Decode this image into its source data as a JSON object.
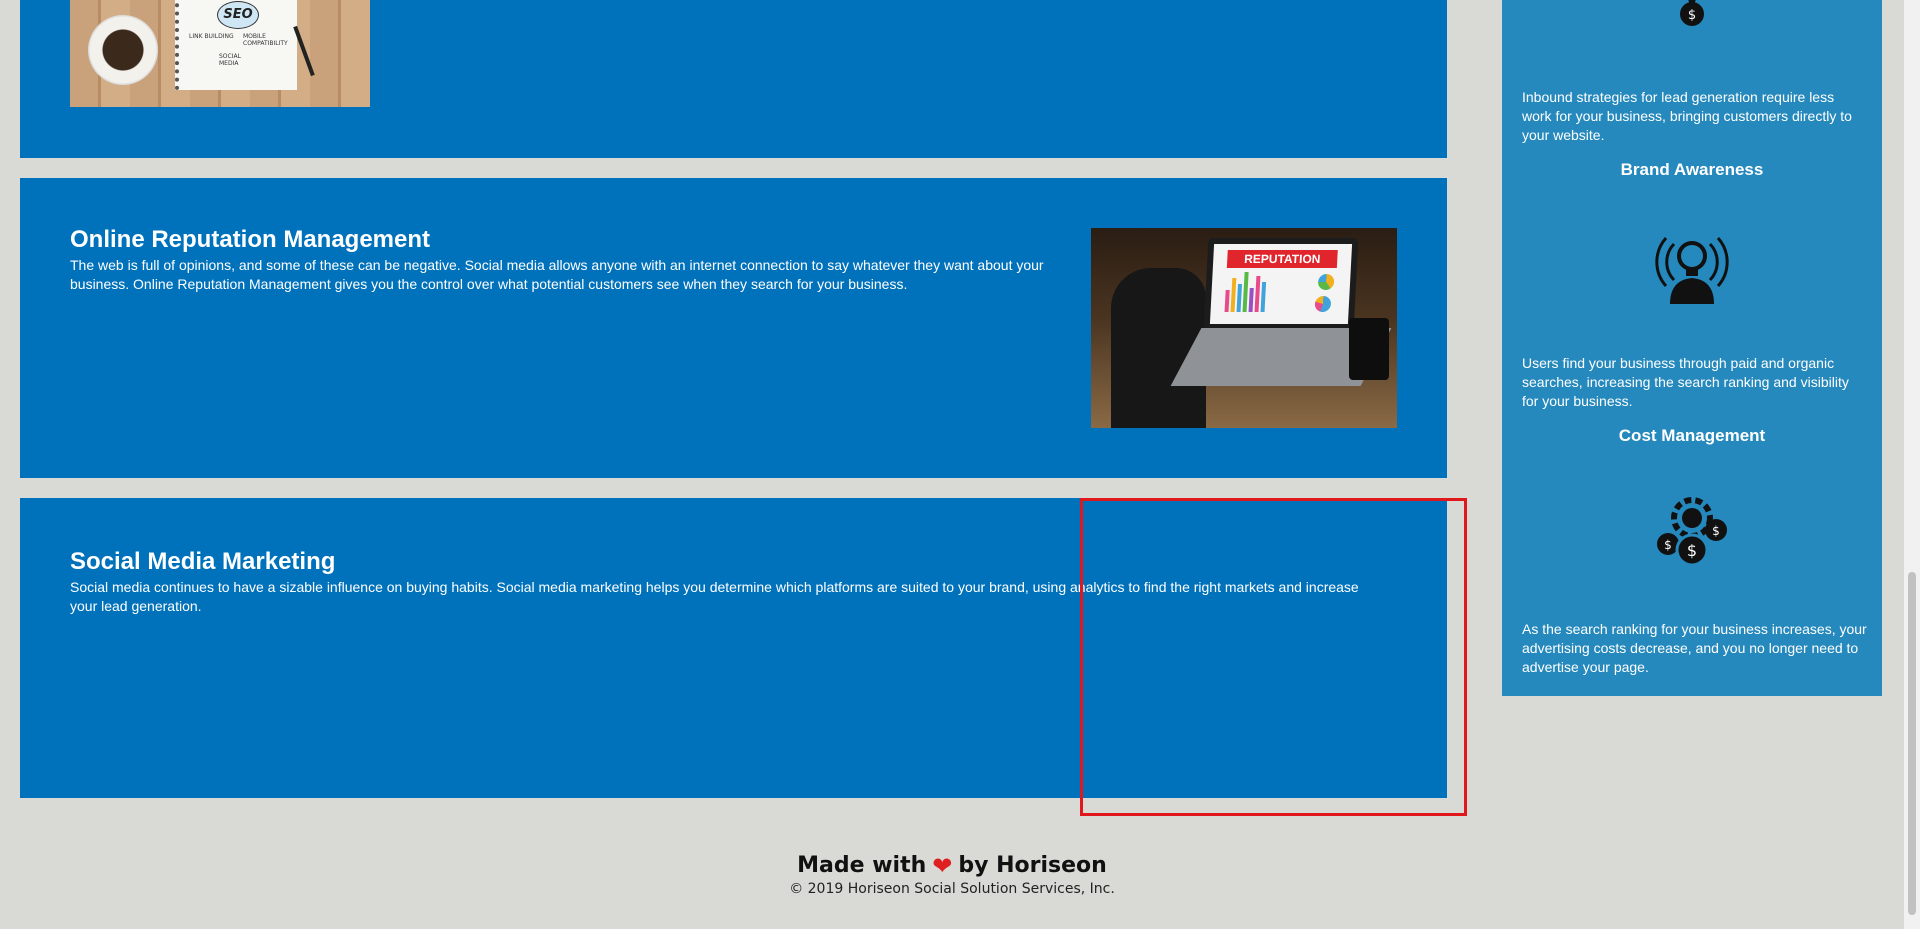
{
  "services": [
    {
      "title": "",
      "text": "",
      "image_alt": "seo",
      "seo_image_words": [
        "SEO",
        "LINK BUILDING",
        "MOBILE COMPATIBILITY",
        "SOCIAL MEDIA"
      ]
    },
    {
      "title": "Online Reputation Management",
      "text": "The web is full of opinions, and some of these can be negative. Social media allows anyone with an internet connection to say whatever they want about your business. Online Reputation Management gives you the control over what potential customers see when they search for your business.",
      "image_banner": "REPUTATION"
    },
    {
      "title": "Social Media Marketing",
      "text": "Social media continues to have a sizable influence on buying habits. Social media marketing helps you determine which platforms are suited to your brand, using analytics to find the right markets and increase your lead generation."
    }
  ],
  "sidebar": {
    "lead_text": "Inbound strategies for lead generation require less work for your business, bringing customers directly to your website.",
    "brand": {
      "heading": "Brand Awareness",
      "text": "Users find your business through paid and organic searches, increasing the search ranking and visibility for your business.",
      "icon": "lightbulb-broadcast-icon"
    },
    "cost": {
      "heading": "Cost Management",
      "text": "As the search ranking for your business increases, your advertising costs decrease, and you no longer need to advertise your page.",
      "icon": "gear-dollar-icon"
    },
    "top_icon": "magnet-dollar-icon"
  },
  "footer": {
    "made_with": "Made with",
    "by": "by Horiseon",
    "heart": "❤",
    "copyright": "© 2019 Horiseon Social Solution Services, Inc."
  },
  "colors": {
    "card": "#0072bb",
    "sidebar": "#2589bd",
    "background": "#d9dad6",
    "highlight": "#e0181b"
  }
}
